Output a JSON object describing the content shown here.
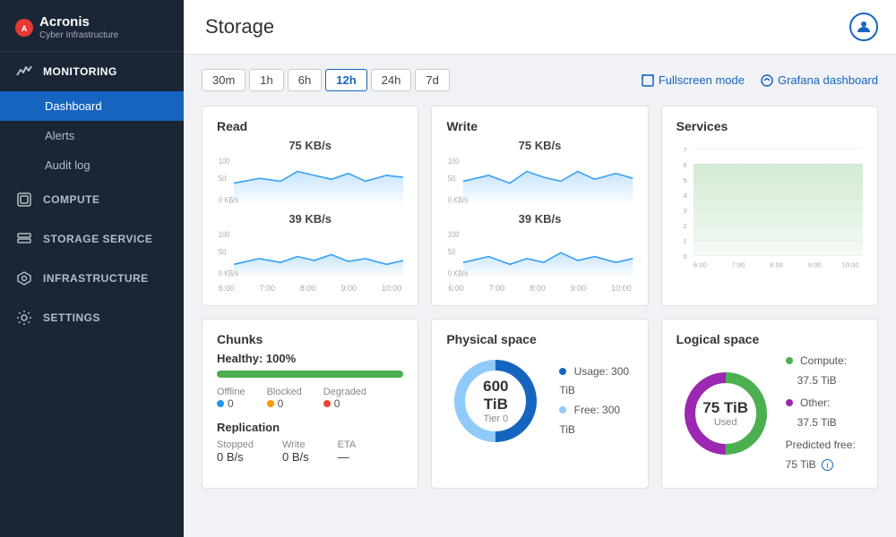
{
  "app": {
    "logo_main": "Acronis",
    "logo_sub": "Cyber Infrastructure"
  },
  "sidebar": {
    "sections": [
      {
        "id": "monitoring",
        "label": "MONITORING",
        "icon": "monitoring-icon"
      },
      {
        "id": "compute",
        "label": "COMPUTE",
        "icon": "compute-icon"
      },
      {
        "id": "storage-service",
        "label": "STORAGE SERVICE",
        "icon": "storage-icon"
      },
      {
        "id": "infrastructure",
        "label": "INFRASTRUCTURE",
        "icon": "infrastructure-icon"
      },
      {
        "id": "settings",
        "label": "SETTINGS",
        "icon": "settings-icon"
      }
    ],
    "sub_items": [
      {
        "id": "dashboard",
        "label": "Dashboard",
        "active": true
      },
      {
        "id": "alerts",
        "label": "Alerts"
      },
      {
        "id": "audit-log",
        "label": "Audit log"
      }
    ]
  },
  "header": {
    "title": "Storage",
    "fullscreen_label": "Fullscreen mode",
    "grafana_label": "Grafana dashboard"
  },
  "time_range": {
    "options": [
      "30m",
      "1h",
      "6h",
      "12h",
      "24h",
      "7d"
    ],
    "active": "12h"
  },
  "cards": {
    "read": {
      "title": "Read",
      "top_value": "75 KB/s",
      "bottom_value": "39 KB/s",
      "x_labels": [
        "6:00",
        "7:00",
        "8:00",
        "9:00",
        "10:00"
      ]
    },
    "write": {
      "title": "Write",
      "top_value": "75 KB/s",
      "bottom_value": "39 KB/s",
      "x_labels": [
        "6:00",
        "7:00",
        "8:00",
        "9:00",
        "10:00"
      ]
    },
    "services": {
      "title": "Services",
      "y_labels": [
        "0",
        "1",
        "2",
        "3",
        "4",
        "5",
        "6",
        "7"
      ],
      "x_labels": [
        "6:00",
        "7:00",
        "8:00",
        "9:00",
        "10:00"
      ]
    },
    "chunks": {
      "title": "Chunks",
      "healthy_label": "Healthy:",
      "healthy_pct": "100%",
      "progress": 100,
      "offline_label": "Offline",
      "offline_val": "0",
      "blocked_label": "Blocked",
      "blocked_val": "0",
      "degraded_label": "Degraded",
      "degraded_val": "0",
      "replication_title": "Replication",
      "stopped_label": "Stopped",
      "stopped_val": "0 B/s",
      "write_label": "Write",
      "write_val": "0 B/s",
      "eta_label": "ETA",
      "eta_val": "—"
    },
    "physical_space": {
      "title": "Physical space",
      "donut_big": "600 TiB",
      "donut_sub": "Tier 0",
      "usage_label": "Usage:",
      "usage_val": "300 TiB",
      "free_label": "Free:",
      "free_val": "300 TiB"
    },
    "logical_space": {
      "title": "Logical space",
      "donut_big": "75 TiB",
      "donut_sub": "Used",
      "compute_label": "Compute:",
      "compute_val": "37.5 TiB",
      "other_label": "Other:",
      "other_val": "37.5 TiB",
      "predicted_label": "Predicted free:",
      "predicted_val": "75 TiB"
    }
  }
}
